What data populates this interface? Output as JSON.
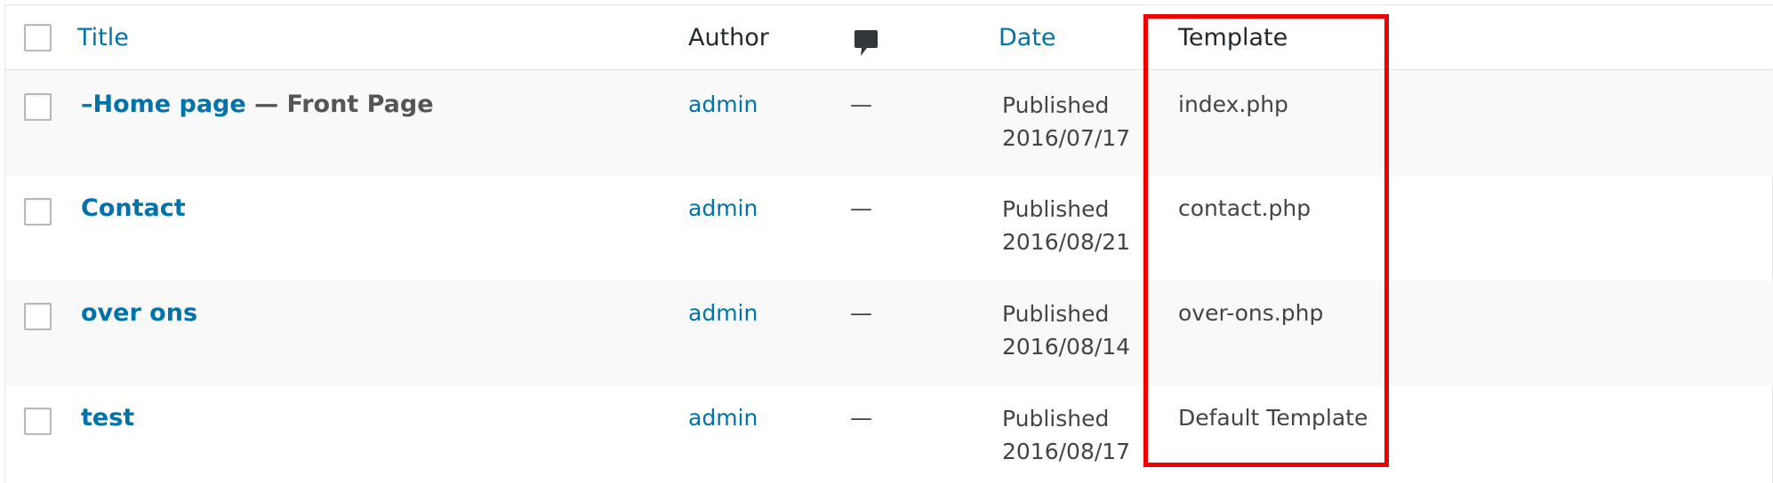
{
  "table": {
    "columns": {
      "title": "Title",
      "author": "Author",
      "comments_icon": "comment-bubble-icon",
      "date": "Date",
      "template": "Template"
    },
    "rows": [
      {
        "title": "–Home page",
        "post_state": " — Front Page",
        "author": "admin",
        "comments": "—",
        "date_status": "Published",
        "date_value": "2016/07/17",
        "template": "index.php"
      },
      {
        "title": "Contact",
        "post_state": "",
        "author": "admin",
        "comments": "—",
        "date_status": "Published",
        "date_value": "2016/08/21",
        "template": "contact.php"
      },
      {
        "title": "over ons",
        "post_state": "",
        "author": "admin",
        "comments": "—",
        "date_status": "Published",
        "date_value": "2016/08/14",
        "template": "over-ons.php"
      },
      {
        "title": "test",
        "post_state": "",
        "author": "admin",
        "comments": "—",
        "date_status": "Published",
        "date_value": "2016/08/17",
        "template": "Default Template"
      }
    ]
  },
  "colors": {
    "link": "#0073aa",
    "highlight": "#f00000",
    "alt_row": "#f9f9f9"
  }
}
